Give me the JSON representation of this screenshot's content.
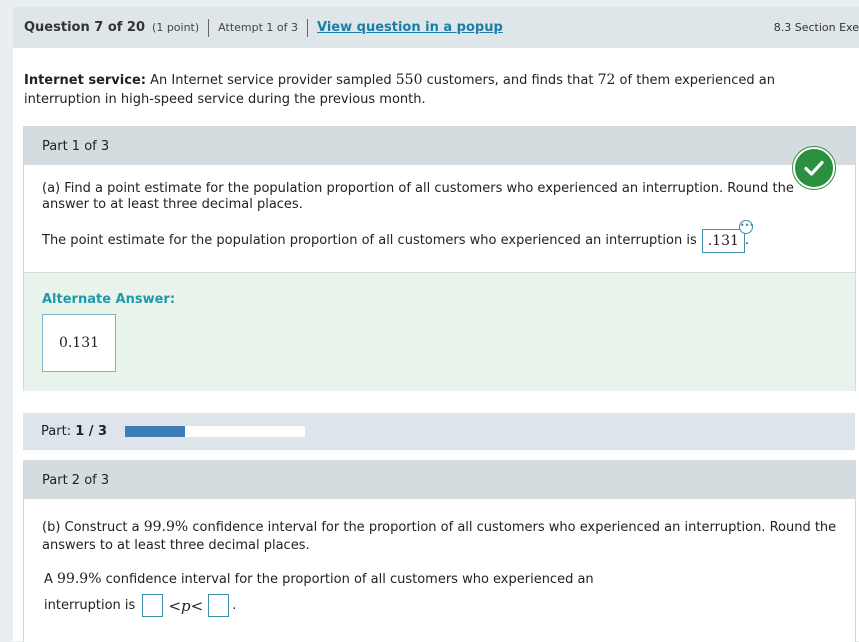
{
  "header": {
    "question": "Question 7 of 20",
    "points": "(1 point)",
    "attempt": "Attempt 1 of 3",
    "popup_link": "View question in a popup",
    "section": "8.3 Section Exe"
  },
  "intro": {
    "title": "Internet service:",
    "text_a": " An Internet service provider sampled ",
    "n": "550",
    "text_b": " customers, and finds that ",
    "x": "72",
    "text_c": " of them experienced an interruption in high-speed service during the previous month."
  },
  "part1": {
    "label": "Part 1 of 3",
    "question": "(a) Find a point estimate for the population proportion of all customers who experienced an interruption. Round the answer to at least three decimal places.",
    "answer_prefix": "The point estimate for the population proportion of all customers who experienced an interruption is",
    "answer_value": ".131",
    "answer_suffix": ".",
    "status": "correct",
    "alt_title": "Alternate Answer:",
    "alt_value": "0.131"
  },
  "progress": {
    "label": "Part:",
    "value_text": "1 / 3",
    "fraction": 0.333
  },
  "part2": {
    "label": "Part 2 of 3",
    "question_a": "(b) Construct a ",
    "conf": "99.9%",
    "question_b": " confidence interval for the proportion of all customers who experienced an interruption. Round the answers to at least three decimal places.",
    "line1_a": "A ",
    "line1_b": " confidence interval for the proportion of all customers who experienced an",
    "line2": "interruption is",
    "lower_value": "",
    "upper_value": "",
    "less_than": "<",
    "p": "p",
    "period": "."
  },
  "colors": {
    "accent": "#1a7fa8",
    "correct": "#2a8f3e",
    "alt_title": "#1d9bab",
    "progress_fill": "#3e7cb8"
  }
}
